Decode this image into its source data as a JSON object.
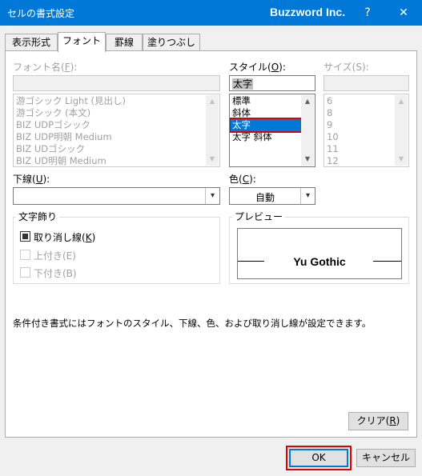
{
  "window": {
    "title": "セルの書式設定",
    "brand": "Buzzword Inc.",
    "help_label": "?",
    "close_label": "✕"
  },
  "tabs": [
    {
      "label": "表示形式",
      "active": false
    },
    {
      "label": "フォント",
      "active": true
    },
    {
      "label": "罫線",
      "active": false
    },
    {
      "label": "塗りつぶし",
      "active": false
    }
  ],
  "font_name": {
    "label": "フォント名",
    "hotkey": "F",
    "value": "",
    "items": [
      "游ゴシック Light (見出し)",
      "游ゴシック (本文)",
      "BIZ UDPゴシック",
      "BIZ UDP明朝 Medium",
      "BIZ UDゴシック",
      "BIZ UD明朝 Medium"
    ]
  },
  "style": {
    "label": "スタイル",
    "hotkey": "O",
    "value": "太字",
    "items": [
      "標準",
      "斜体",
      "太字",
      "太字 斜体"
    ],
    "selected_index": 2
  },
  "size": {
    "label": "サイズ",
    "hotkey": "S",
    "value": "",
    "items": [
      "6",
      "8",
      "9",
      "10",
      "11",
      "12"
    ]
  },
  "underline": {
    "label": "下線",
    "hotkey": "U",
    "value": ""
  },
  "color": {
    "label": "色",
    "hotkey": "C",
    "value": "自動"
  },
  "effects": {
    "title": "文字飾り",
    "strikethrough": {
      "label": "取り消し線",
      "hotkey": "K",
      "checked": true
    },
    "superscript": {
      "label": "上付き(E)",
      "checked": false
    },
    "subscript": {
      "label": "下付き(B)",
      "checked": false
    }
  },
  "preview": {
    "title": "プレビュー",
    "sample": "Yu Gothic"
  },
  "description": "条件付き書式にはフォントのスタイル、下線、色、および取り消し線が設定できます。",
  "buttons": {
    "clear": {
      "label": "クリア",
      "hotkey": "R"
    },
    "ok": "OK",
    "cancel": "キャンセル"
  },
  "colors": {
    "titlebar": "#0078d7",
    "selection": "#0078d7",
    "highlight": "#e00000"
  }
}
